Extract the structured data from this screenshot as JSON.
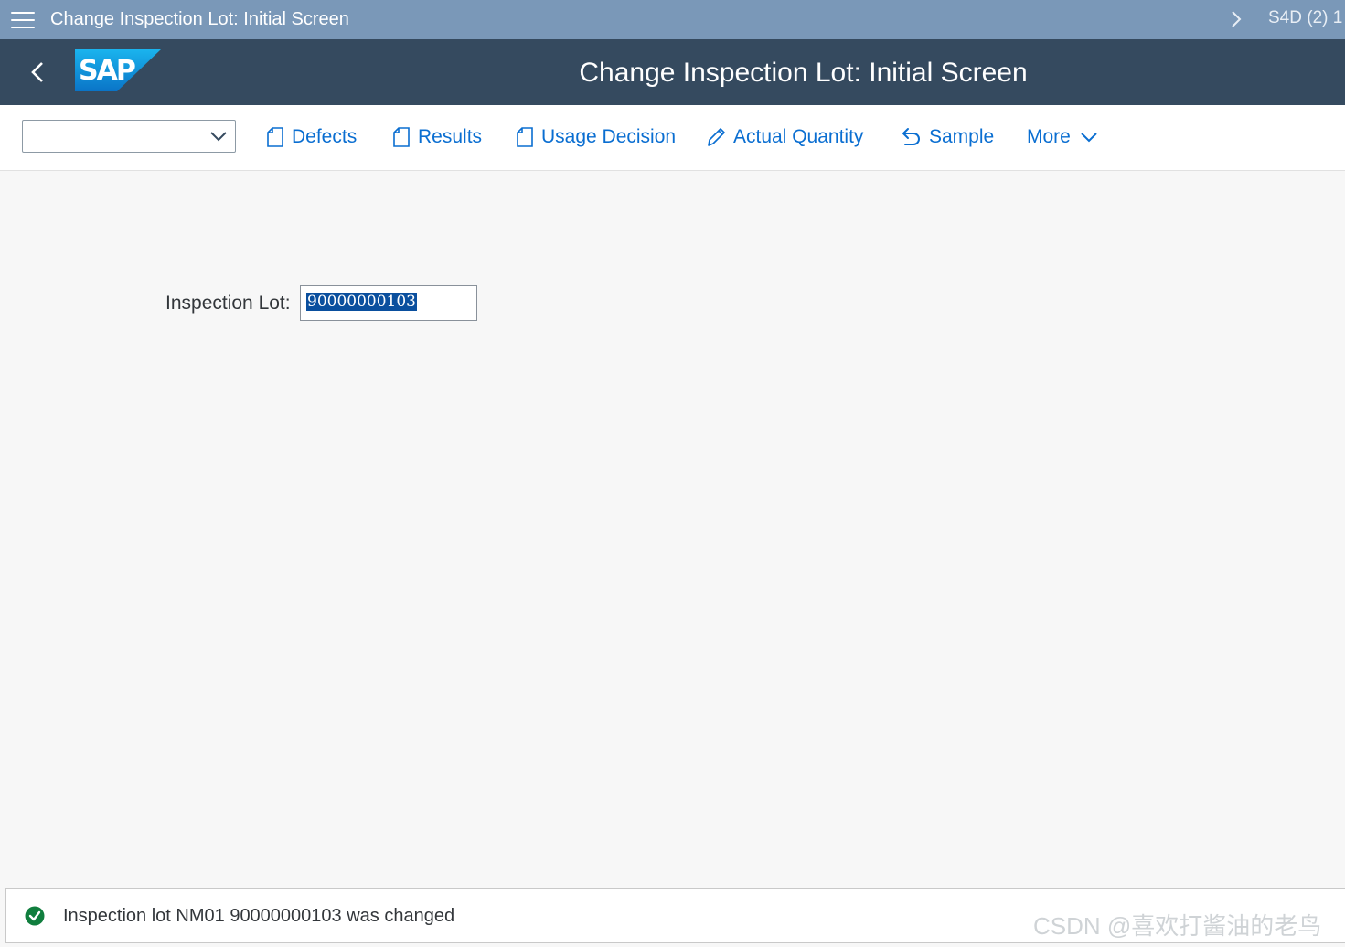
{
  "window": {
    "title": "Change Inspection Lot: Initial Screen",
    "system": "S4D (2) 1"
  },
  "shell": {
    "title": "Change Inspection Lot: Initial Screen",
    "logo_text": "SAP"
  },
  "toolbar": {
    "combo_value": "",
    "buttons": [
      {
        "label": "Defects",
        "icon": "document-icon"
      },
      {
        "label": "Results",
        "icon": "document-icon"
      },
      {
        "label": "Usage Decision",
        "icon": "document-icon"
      },
      {
        "label": "Actual Quantity",
        "icon": "pencil-icon"
      },
      {
        "label": "Sample",
        "icon": "undo-arrow-icon"
      },
      {
        "label": "More",
        "icon": "chevron-down-icon"
      }
    ]
  },
  "form": {
    "inspection_lot_label": "Inspection Lot:",
    "inspection_lot_value": "90000000103"
  },
  "status": {
    "type": "success",
    "message": "Inspection lot NM01 90000000103 was changed"
  },
  "watermark": "CSDN @喜欢打酱油的老鸟",
  "colors": {
    "title_bar": "#7a98b8",
    "shell_bar": "#354a5f",
    "accent": "#0a6ed1",
    "success": "#107e3e"
  }
}
